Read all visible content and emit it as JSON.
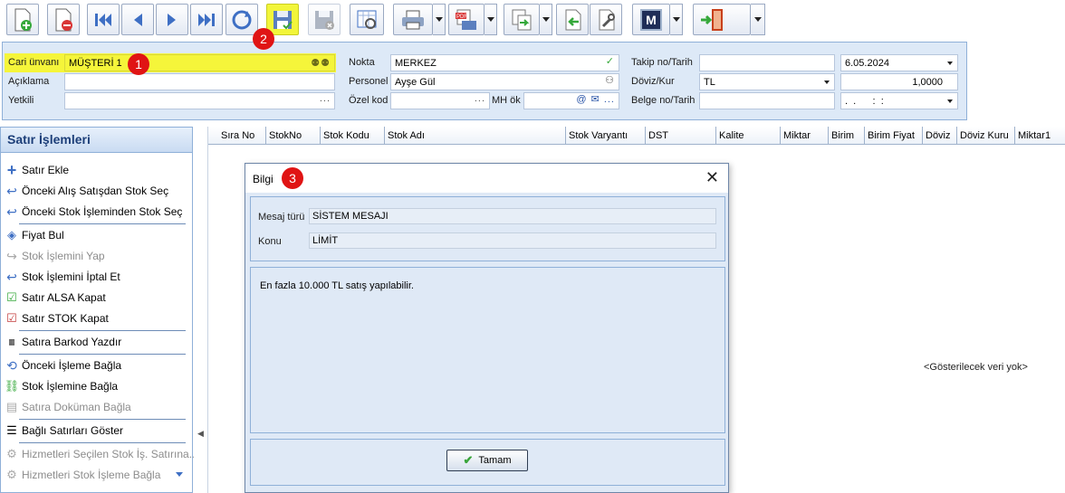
{
  "toolbar": {
    "buttons": [
      {
        "icon": "new-document-icon"
      },
      {
        "icon": "delete-document-icon"
      },
      {
        "icon": "first-record-icon"
      },
      {
        "icon": "previous-record-icon"
      },
      {
        "icon": "next-record-icon"
      },
      {
        "icon": "last-record-icon"
      },
      {
        "icon": "refresh-icon"
      },
      {
        "icon": "save-icon"
      },
      {
        "icon": "cancel-save-icon"
      },
      {
        "icon": "preview-icon"
      },
      {
        "icon": "print-icon"
      },
      {
        "icon": "pdf-export-icon"
      },
      {
        "icon": "transfer-icon"
      },
      {
        "icon": "import-icon"
      },
      {
        "icon": "settings-wrench-icon"
      },
      {
        "icon": "m-brand-icon",
        "text": "M"
      },
      {
        "icon": "exit-door-icon"
      }
    ],
    "highlight_color": "#f2f53a"
  },
  "badges": [
    "1",
    "2",
    "3"
  ],
  "header": {
    "cari_unvani_label": "Cari ünvanı",
    "cari_unvani_value": "MÜŞTERİ 1",
    "aciklama_label": "Açıklama",
    "yetkili_label": "Yetkili",
    "nokta_label": "Nokta",
    "nokta_value": "MERKEZ",
    "personel_label": "Personel",
    "personel_value": "Ayşe Gül",
    "ozel_kod_label": "Özel kod",
    "mh_ok_label": "MH ök",
    "takip_label": "Takip no/Tarih",
    "takip_date": "6.05.2024",
    "doviz_label": "Döviz/Kur",
    "doviz_value": "TL",
    "kur_value": "1,0000",
    "belge_label": "Belge no/Tarih",
    "belge_date": ".  .      :  :"
  },
  "left_panel": {
    "title": "Satır İşlemleri",
    "items": [
      {
        "label": "Satır Ekle",
        "icon": "plus-icon",
        "enabled": true
      },
      {
        "label": "Önceki Alış Satışdan Stok Seç",
        "icon": "return-arrow-icon",
        "enabled": true
      },
      {
        "label": "Önceki Stok İşleminden Stok Seç",
        "icon": "return-arrow-icon",
        "enabled": true
      },
      {
        "label": "Fiyat Bul",
        "icon": "price-tag-icon",
        "enabled": true
      },
      {
        "label": "Stok İşlemini Yap",
        "icon": "forward-arrow-icon",
        "enabled": false
      },
      {
        "label": "Stok İşlemini İptal Et",
        "icon": "undo-arrow-icon",
        "enabled": true
      },
      {
        "label": "Satır ALSA Kapat",
        "icon": "check-sheet-icon",
        "enabled": true
      },
      {
        "label": "Satır STOK Kapat",
        "icon": "check-sheet-red-icon",
        "enabled": true
      },
      {
        "label": "Satıra Barkod Yazdır",
        "icon": "barcode-icon",
        "enabled": true
      },
      {
        "label": "Önceki İşleme Bağla",
        "icon": "link-back-icon",
        "enabled": true
      },
      {
        "label": "Stok İşlemine Bağla",
        "icon": "link-icon",
        "enabled": true
      },
      {
        "label": "Satıra Doküman Bağla",
        "icon": "document-icon",
        "enabled": false
      },
      {
        "label": "Bağlı Satırları Göster",
        "icon": "list-icon",
        "enabled": true
      },
      {
        "label": "Hizmetleri Seçilen Stok İş. Satırına...",
        "icon": "gear-link-icon",
        "enabled": false
      },
      {
        "label": "Hizmetleri Stok İşleme Bağla",
        "icon": "gear-link-icon",
        "enabled": false
      }
    ]
  },
  "grid": {
    "columns": [
      "Sıra No",
      "StokNo",
      "Stok Kodu",
      "Stok Adı",
      "Stok Varyantı",
      "DST",
      "Kalite",
      "Miktar",
      "Birim",
      "Birim Fiyat",
      "Döviz",
      "Döviz Kuru",
      "Miktar1"
    ],
    "empty_text": "<Gösterilecek veri yok>"
  },
  "dialog": {
    "title": "Bilgi",
    "mesaj_turu_label": "Mesaj türü",
    "mesaj_turu_value": "SİSTEM MESAJI",
    "konu_label": "Konu",
    "konu_value": "LİMİT",
    "message": "En fazla 10.000 TL satış yapılabilir.",
    "ok_label": "Tamam"
  }
}
